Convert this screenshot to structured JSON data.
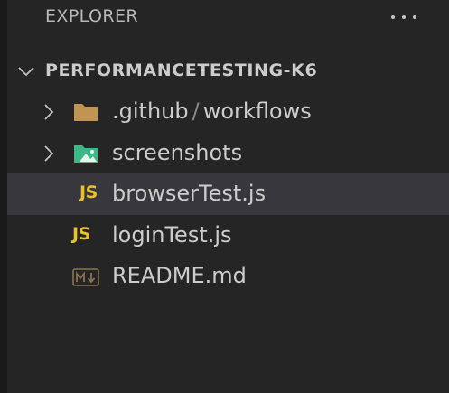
{
  "explorer": {
    "title": "EXPLORER",
    "more_icon": "ellipsis-icon"
  },
  "project": {
    "name": "PERFORMANCETESTING-K6",
    "expanded": true
  },
  "tree": {
    "items": [
      {
        "label_a": ".github",
        "separator": "/",
        "label_b": "workflows",
        "type": "folder",
        "icon": "folder-icon",
        "icon_color": "#c09553"
      },
      {
        "label": "screenshots",
        "type": "folder",
        "icon": "folder-images-icon",
        "icon_color": "#3fb888"
      },
      {
        "label": "browserTest.js",
        "type": "file",
        "icon": "js-file-icon",
        "icon_text": "JS",
        "icon_color": "#e8c12b",
        "selected": true
      },
      {
        "label": "loginTest.js",
        "type": "file",
        "icon": "js-file-icon",
        "icon_text": "JS",
        "icon_color": "#e8c12b"
      },
      {
        "label": "README.md",
        "type": "file",
        "icon": "markdown-file-icon",
        "icon_color": "#8a7450"
      }
    ]
  },
  "colors": {
    "background": "#252526",
    "selected_row": "#37373d",
    "text": "#cccccc"
  }
}
